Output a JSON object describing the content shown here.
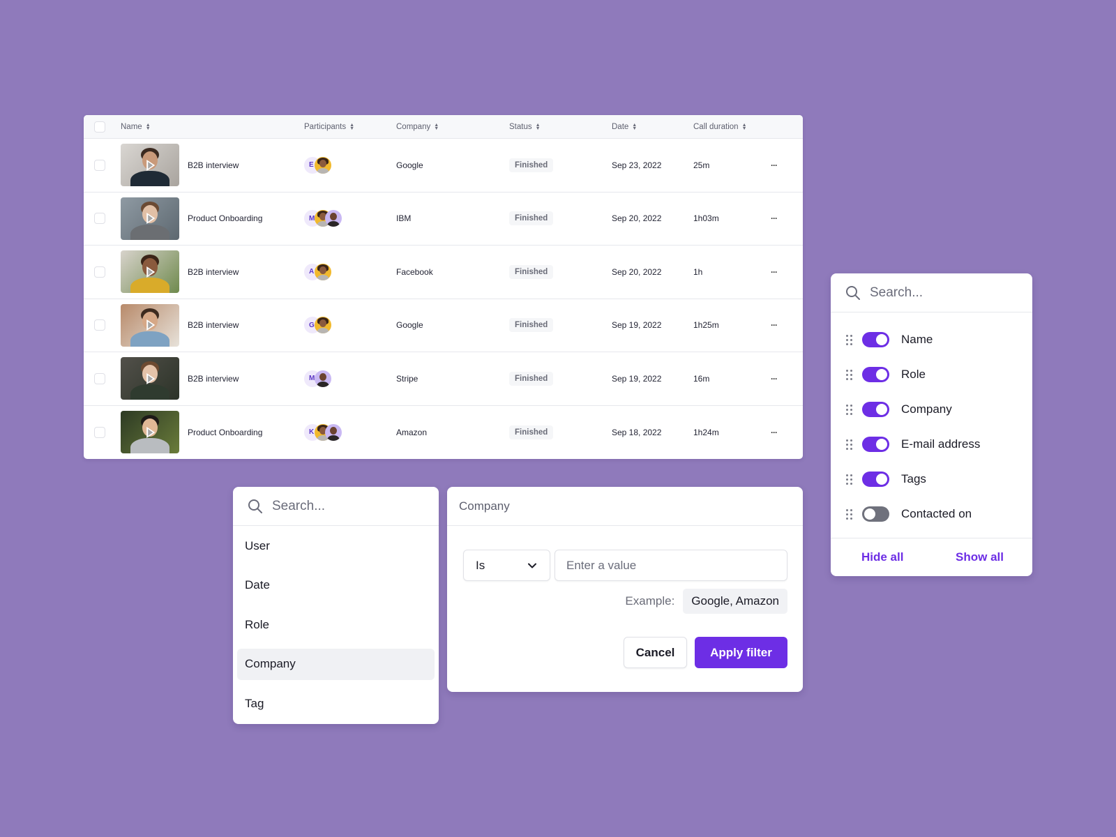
{
  "colors": {
    "background": "#8f7abb",
    "accent": "#6d2ee5",
    "toggle_off": "#6f717c",
    "status_badge_bg": "#f5f6f8",
    "initial_avatar_bg": "#efe9fb"
  },
  "table": {
    "columns": [
      {
        "label": "Name",
        "sortable": true
      },
      {
        "label": "Participants",
        "sortable": true
      },
      {
        "label": "Company",
        "sortable": true
      },
      {
        "label": "Status",
        "sortable": true
      },
      {
        "label": "Date",
        "sortable": true
      },
      {
        "label": "Call duration",
        "sortable": true
      }
    ],
    "rows": [
      {
        "name": "B2B interview",
        "participants": [
          "E",
          "photo-woman"
        ],
        "company": "Google",
        "status": "Finished",
        "date": "Sep 23, 2022",
        "duration": "25m"
      },
      {
        "name": "Product Onboarding",
        "participants": [
          "M",
          "photo-woman",
          "photo-man"
        ],
        "company": "IBM",
        "status": "Finished",
        "date": "Sep 20, 2022",
        "duration": "1h03m"
      },
      {
        "name": "B2B interview",
        "participants": [
          "A",
          "photo-woman"
        ],
        "company": "Facebook",
        "status": "Finished",
        "date": "Sep 20, 2022",
        "duration": "1h"
      },
      {
        "name": "B2B interview",
        "participants": [
          "G",
          "photo-woman"
        ],
        "company": "Google",
        "status": "Finished",
        "date": "Sep 19, 2022",
        "duration": "1h25m"
      },
      {
        "name": "B2B interview",
        "participants": [
          "M",
          "photo-man"
        ],
        "company": "Stripe",
        "status": "Finished",
        "date": "Sep 19, 2022",
        "duration": "16m"
      },
      {
        "name": "Product Onboarding",
        "participants": [
          "K",
          "photo-woman",
          "photo-man"
        ],
        "company": "Amazon",
        "status": "Finished",
        "date": "Sep 18, 2022",
        "duration": "1h24m"
      }
    ],
    "row_action_icon": "more-horizontal-icon",
    "thumbnail_overlay_icon": "play-icon"
  },
  "field_picker": {
    "search_placeholder": "Search...",
    "items": [
      "User",
      "Date",
      "Role",
      "Company",
      "Tag"
    ],
    "selected": "Company"
  },
  "filter_panel": {
    "title": "Company",
    "operator": "Is",
    "value_placeholder": "Enter a value",
    "example_label": "Example:",
    "example_value": "Google, Amazon",
    "cancel_label": "Cancel",
    "apply_label": "Apply filter"
  },
  "columns_panel": {
    "search_placeholder": "Search...",
    "items": [
      {
        "label": "Name",
        "enabled": true
      },
      {
        "label": "Role",
        "enabled": true
      },
      {
        "label": "Company",
        "enabled": true
      },
      {
        "label": "E-mail address",
        "enabled": true
      },
      {
        "label": "Tags",
        "enabled": true
      },
      {
        "label": "Contacted on",
        "enabled": false
      }
    ],
    "hide_all_label": "Hide all",
    "show_all_label": "Show all"
  }
}
